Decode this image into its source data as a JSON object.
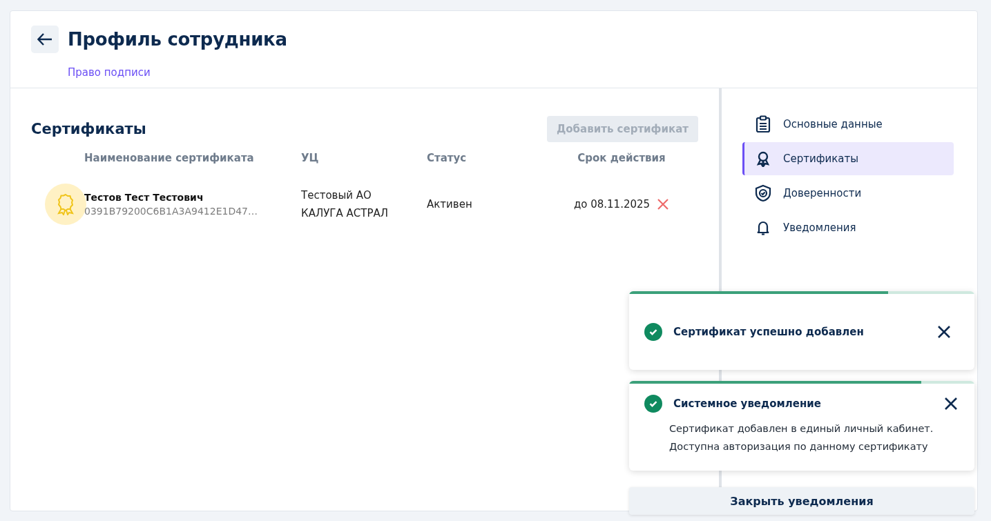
{
  "header": {
    "title": "Профиль сотрудника",
    "subtitle": "Право подписи"
  },
  "certificates": {
    "title": "Сертификаты",
    "add_button": {
      "label": "Добавить сертификат",
      "disabled": true
    },
    "columns": [
      "Наименование сертификата",
      "УЦ",
      "Статус",
      "Срок действия"
    ],
    "rows": [
      {
        "name": "Тестов Тест Тестович",
        "serial": "0391B79200C6B1A3A9412E1D47…",
        "ca": [
          "Тестовый АО",
          "КАЛУГА АСТРАЛ"
        ],
        "status": "Активен",
        "expiry": "до 08.11.2025"
      }
    ]
  },
  "sidebar": {
    "items": [
      {
        "label": "Основные данные",
        "selected": false
      },
      {
        "label": "Сертификаты",
        "selected": true
      },
      {
        "label": "Доверенности",
        "selected": false
      },
      {
        "label": "Уведомления",
        "selected": false
      }
    ]
  },
  "notifications": {
    "items": [
      {
        "title": "Сертификат успешно добавлен",
        "level": 0.75
      },
      {
        "title": "Системное уведомление",
        "message": [
          "Сертификат добавлен в единый личный кабинет.",
          "Доступна авторизация по данному сертификату"
        ],
        "level": 0.845
      }
    ],
    "close_all": "Закрыть уведомления"
  }
}
